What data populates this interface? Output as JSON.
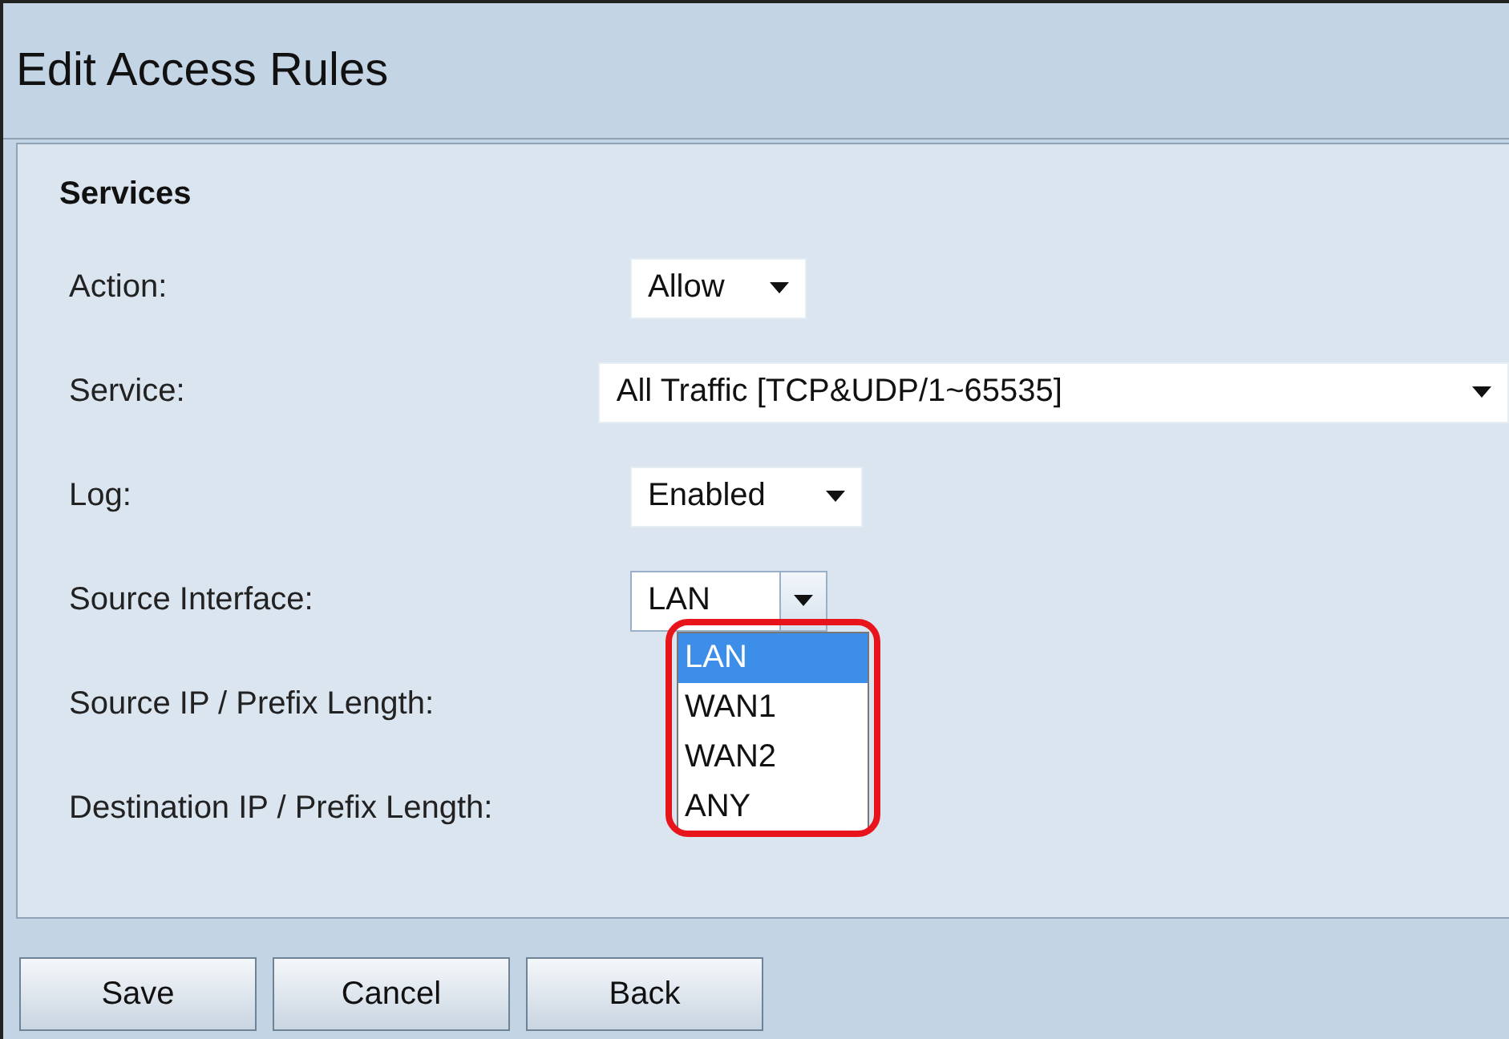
{
  "title": "Edit Access Rules",
  "section": "Services",
  "fields": [
    {
      "label": "Action:",
      "kind": "select",
      "value": "Allow"
    },
    {
      "label": "Service:",
      "kind": "select",
      "value": "All Traffic [TCP&UDP/1~65535]"
    },
    {
      "label": "Log:",
      "kind": "select",
      "value": "Enabled"
    },
    {
      "label": "Source Interface:",
      "kind": "open-select",
      "value": "LAN",
      "options": [
        {
          "label": "LAN",
          "selected": true
        },
        {
          "label": "WAN1",
          "selected": false
        },
        {
          "label": "WAN2",
          "selected": false
        },
        {
          "label": "ANY",
          "selected": false
        }
      ]
    },
    {
      "label": "Source IP / Prefix Length:",
      "kind": "blank"
    },
    {
      "label": "Destination IP / Prefix Length:",
      "kind": "blank"
    }
  ],
  "buttons": [
    "Save",
    "Cancel",
    "Back"
  ]
}
